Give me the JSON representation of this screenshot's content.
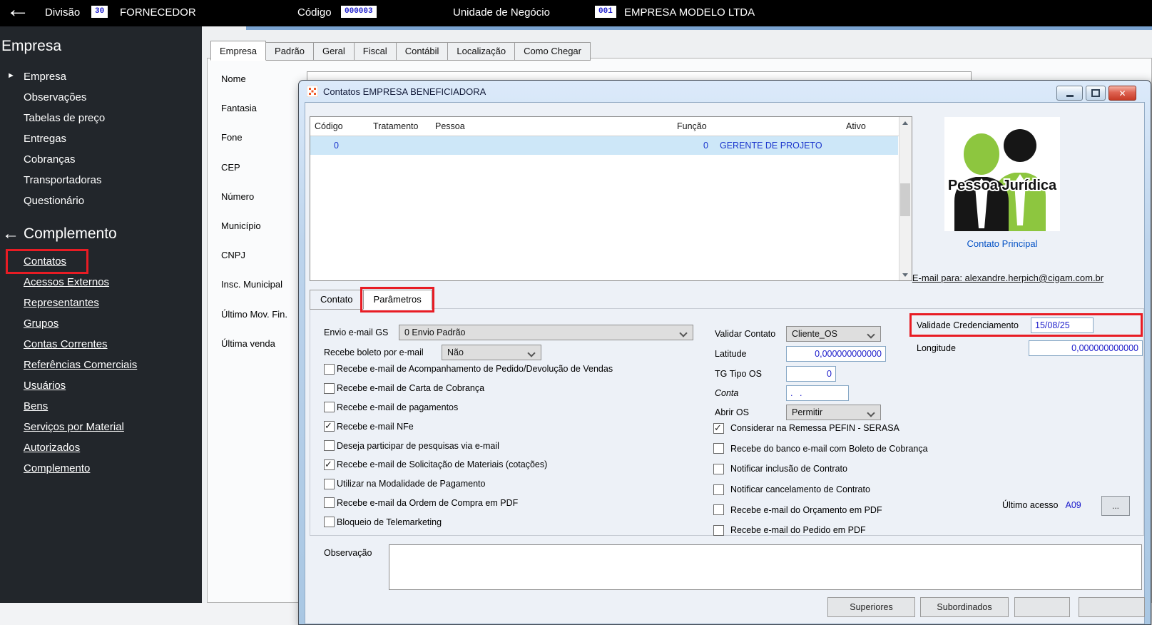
{
  "topbar": {
    "divisao_label": "Divisão",
    "divisao_value": "30",
    "divisao_text": "FORNECEDOR",
    "codigo_label": "Código",
    "codigo_value": "000003",
    "unidade_label": "Unidade de Negócio",
    "unidade_value": "001",
    "unidade_text": "EMPRESA MODELO LTDA"
  },
  "sidebar": {
    "section1": {
      "title": "Empresa",
      "items": [
        {
          "label": "Empresa"
        },
        {
          "label": "Observações"
        },
        {
          "label": "Tabelas de preço"
        },
        {
          "label": "Entregas"
        },
        {
          "label": "Cobranças"
        },
        {
          "label": "Transportadoras"
        },
        {
          "label": "Questionário"
        }
      ]
    },
    "section2": {
      "title": "Complemento",
      "items": [
        {
          "label": "Contatos",
          "highlighted": true
        },
        {
          "label": "Acessos Externos"
        },
        {
          "label": "Representantes"
        },
        {
          "label": "Grupos"
        },
        {
          "label": "Contas Correntes"
        },
        {
          "label": "Referências Comerciais"
        },
        {
          "label": "Usuários"
        },
        {
          "label": "Bens"
        },
        {
          "label": "Serviços por Material"
        },
        {
          "label": "Autorizados"
        },
        {
          "label": "Complemento"
        }
      ]
    }
  },
  "main": {
    "tabs": [
      {
        "label": "Empresa",
        "active": true
      },
      {
        "label": "Padrão"
      },
      {
        "label": "Geral"
      },
      {
        "label": "Fiscal"
      },
      {
        "label": "Contábil"
      },
      {
        "label": "Localização"
      },
      {
        "label": "Como Chegar"
      }
    ],
    "field_labels": [
      {
        "label": "Nome"
      },
      {
        "label": "Fantasia"
      },
      {
        "label": "Fone"
      },
      {
        "label": "CEP"
      },
      {
        "label": "Número"
      },
      {
        "label": "Município"
      },
      {
        "label": "CNPJ"
      },
      {
        "label": "Insc. Municipal"
      },
      {
        "label": "Último Mov. Fin."
      },
      {
        "label": "Última venda"
      }
    ]
  },
  "dialog": {
    "title": "Contatos EMPRESA BENEFICIADORA",
    "table": {
      "columns": [
        {
          "label": "Código"
        },
        {
          "label": "Tratamento"
        },
        {
          "label": "Pessoa"
        },
        {
          "label": "Função"
        },
        {
          "label": "Ativo"
        }
      ],
      "row": {
        "codigo": "0",
        "tratamento": "",
        "pessoa": "",
        "funcao_num": "0",
        "funcao_name": "GERENTE DE PROJETO",
        "ativo": ""
      }
    },
    "contact_panel": {
      "image_caption": "Pessoa Jurídica",
      "primary_link": "Contato Principal",
      "email_link": "E-mail para: alexandre.herpich@cigam.com.br"
    },
    "tabs": [
      {
        "label": "Contato"
      },
      {
        "label": "Parâmetros",
        "active": true,
        "highlighted": true
      }
    ],
    "params": {
      "envio_email_label": "Envio e-mail GS",
      "envio_email_value": "0 Envio Padrão",
      "boleto_label": "Recebe boleto por e-mail",
      "boleto_value": "Não",
      "left_checkboxes": [
        {
          "label": "Recebe e-mail de Acompanhamento de Pedido/Devolução de Vendas",
          "checked": false
        },
        {
          "label": "Recebe e-mail de Carta de Cobrança",
          "checked": false
        },
        {
          "label": "Recebe e-mail de pagamentos",
          "checked": false
        },
        {
          "label": "Recebe e-mail NFe",
          "checked": true
        },
        {
          "label": "Deseja participar de pesquisas via e-mail",
          "checked": false
        },
        {
          "label": "Recebe e-mail de Solicitação de Materiais (cotações)",
          "checked": true
        },
        {
          "label": "Utilizar na Modalidade de Pagamento",
          "checked": false
        },
        {
          "label": "Recebe e-mail da Ordem de Compra em PDF",
          "checked": false
        },
        {
          "label": "Bloqueio de Telemarketing",
          "checked": false
        }
      ],
      "validar_label": "Validar Contato",
      "validar_value": "Cliente_OS",
      "latitude_label": "Latitude",
      "latitude_value": "0,000000000000",
      "tg_tipo_label": "TG Tipo OS",
      "tg_tipo_value": "0",
      "conta_label": "Conta",
      "conta_value": ". .",
      "abrir_label": "Abrir OS",
      "abrir_value": "Permitir",
      "right_checkboxes": [
        {
          "label": "Considerar na Remessa PEFIN - SERASA",
          "checked": true
        },
        {
          "label": "Recebe do banco e-mail com Boleto de Cobrança",
          "checked": false
        },
        {
          "label": "Notificar inclusão de Contrato",
          "checked": false
        },
        {
          "label": "Notificar cancelamento de Contrato",
          "checked": false
        },
        {
          "label": "Recebe e-mail do Orçamento em PDF",
          "checked": false
        },
        {
          "label": "Recebe e-mail do Pedido em PDF",
          "checked": false
        }
      ],
      "validade_label": "Validade Credenciamento",
      "validade_value": "15/08/25",
      "longitude_label": "Longitude",
      "longitude_value": "0,000000000000",
      "ultimo_acesso_label": "Último acesso",
      "ultimo_acesso_value": "A09",
      "browse_button": "..."
    },
    "observacao_label": "Observação",
    "bottom_buttons": [
      {
        "label": "Superiores"
      },
      {
        "label": "Subordinados"
      },
      {
        "label": ""
      },
      {
        "label": ""
      }
    ]
  },
  "colors": {
    "highlight_red": "#e81c24",
    "value_blue": "#2020cc",
    "selected_row": "#cde7f8",
    "sidebar_bg": "#22262b"
  }
}
